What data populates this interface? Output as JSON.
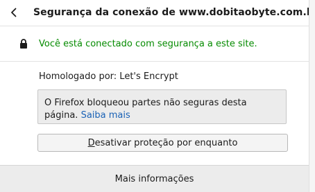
{
  "header": {
    "back_icon": "chevron-left-icon",
    "title": "Segurança da conexão de www.dobitaobyte.com.br"
  },
  "connection": {
    "lock_icon": "lock-icon",
    "status_text": "Você está conectado com segurança a este site.",
    "status_color": "#058b00"
  },
  "verifier": {
    "text": "Homologado por: Let's Encrypt"
  },
  "warning": {
    "text": "O Firefox bloqueou partes não seguras desta página.",
    "link_label": "Saiba mais",
    "link_color": "#1a62b6"
  },
  "disable_button": {
    "access_key": "D",
    "label_rest": "esativar proteção por enquanto"
  },
  "more_info_button": {
    "label": "Mais informações"
  }
}
